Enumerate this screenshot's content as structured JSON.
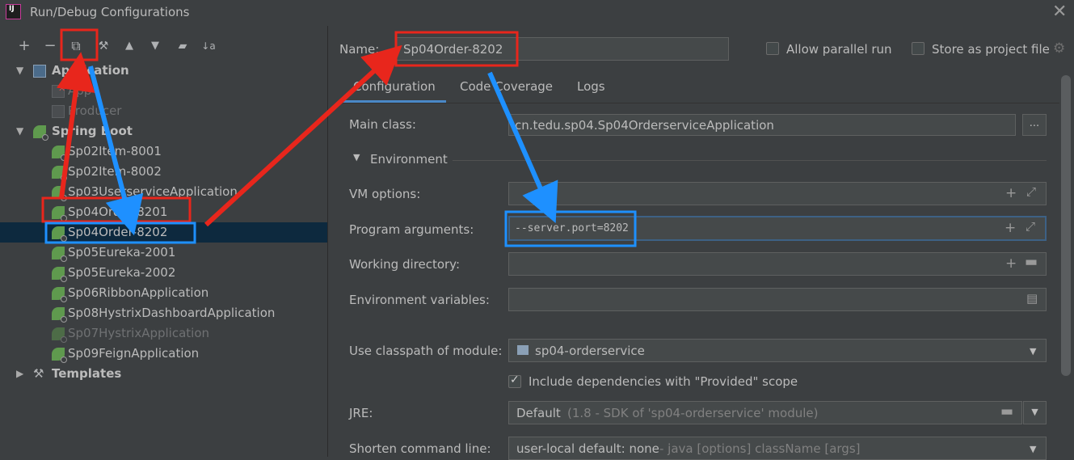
{
  "window": {
    "title": "Run/Debug Configurations"
  },
  "toolbar": {
    "add": "+",
    "remove": "−",
    "copy": "⧉",
    "settings": "🔧",
    "up": "▲",
    "down": "▼",
    "folder": "📁",
    "sort": "↓a"
  },
  "tree": {
    "application": {
      "label": "Application",
      "children": [
        "App",
        "Producer"
      ]
    },
    "spring_boot": {
      "label": "Spring Boot",
      "children": [
        "Sp02Item-8001",
        "Sp02Item-8002",
        "Sp03UserserviceApplication",
        "Sp04Order-8201",
        "Sp04Order-8202",
        "Sp05Eureka-2001",
        "Sp05Eureka-2002",
        "Sp06RibbonApplication",
        "Sp08HystrixDashboardApplication",
        "Sp07HystrixApplication",
        "Sp09FeignApplication"
      ]
    },
    "templates": {
      "label": "Templates"
    }
  },
  "form": {
    "name_label": "Name:",
    "name_value": "Sp04Order-8202",
    "allow_parallel_label": "Allow parallel run",
    "store_project_label": "Store as project file",
    "tabs": [
      "Configuration",
      "Code Coverage",
      "Logs"
    ],
    "main_class_label": "Main class:",
    "main_class_value": "cn.tedu.sp04.Sp04OrderserviceApplication",
    "browse_label": "...",
    "environment_label": "Environment",
    "vm_options_label": "VM options:",
    "program_args_label": "Program arguments:",
    "program_args_value": "--server.port=8202",
    "working_dir_label": "Working directory:",
    "env_vars_label": "Environment variables:",
    "classpath_label": "Use classpath of module:",
    "classpath_value": "sp04-orderservice",
    "include_deps_label": "Include dependencies with \"Provided\" scope",
    "jre_label": "JRE:",
    "jre_value": "Default",
    "jre_detail": "(1.8 - SDK of 'sp04-orderservice' module)",
    "shorten_label": "Shorten command line:",
    "shorten_value": "user-local default: none",
    "shorten_detail": "- java [options] className [args]"
  },
  "colors": {
    "background": "#3c3f41",
    "selection": "#0d293e",
    "focus_border": "#3d6185",
    "annotation_red": "#e8261c",
    "annotation_blue": "#1e90ff"
  }
}
